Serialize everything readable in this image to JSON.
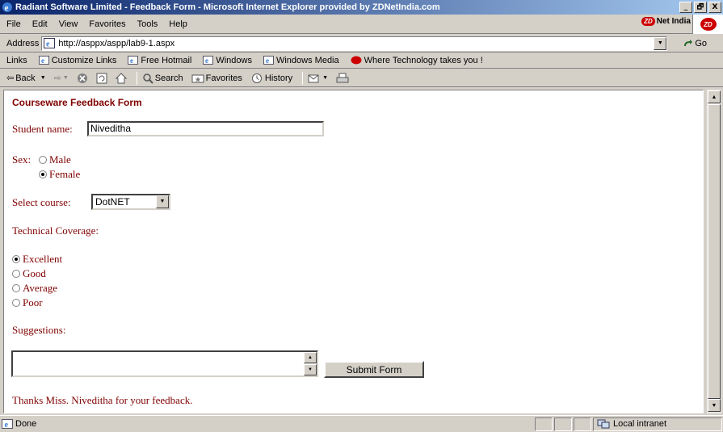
{
  "window": {
    "title": "Radiant Software Limited - Feedback Form - Microsoft Internet Explorer provided by ZDNetIndia.com",
    "controls": [
      "_",
      "🗗",
      "X"
    ]
  },
  "menu": {
    "items": [
      "File",
      "Edit",
      "View",
      "Favorites",
      "Tools",
      "Help"
    ],
    "brand": "Net India",
    "brand_badge": "ZD"
  },
  "address": {
    "label": "Address",
    "url": "http://asppx/aspp/lab9-1.aspx",
    "go_label": "Go"
  },
  "links": {
    "label": "Links",
    "items": [
      "Customize Links",
      "Free Hotmail",
      "Windows",
      "Windows Media",
      "Where Technology takes you !"
    ]
  },
  "toolbar": {
    "back": "Back",
    "search": "Search",
    "favorites": "Favorites",
    "history": "History"
  },
  "form": {
    "heading": "Courseware Feedback Form",
    "student_name_label": "Student name:",
    "student_name_value": "Niveditha",
    "sex_label": "Sex:",
    "sex_options": [
      "Male",
      "Female"
    ],
    "sex_selected": "Female",
    "course_label": "Select course:",
    "course_value": "DotNET",
    "coverage_label": "Technical Coverage:",
    "coverage_options": [
      "Excellent",
      "Good",
      "Average",
      "Poor"
    ],
    "coverage_selected": "Excellent",
    "suggestions_label": "Suggestions:",
    "suggestions_value": "",
    "submit_label": "Submit Form",
    "thanks_message": "Thanks Miss. Niveditha for your feedback."
  },
  "status": {
    "text": "Done",
    "zone": "Local intranet"
  }
}
